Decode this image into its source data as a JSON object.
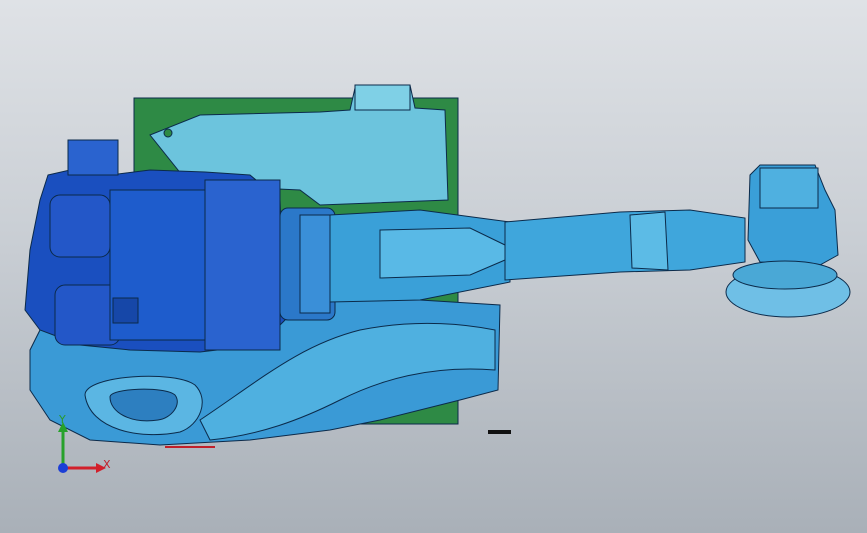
{
  "view": {
    "background_top": "#dfe2e6",
    "background_bottom": "#a9b0b8",
    "model_colors": {
      "base_plate": "#2e8a45",
      "body_light": "#4aa8d6",
      "body_dark": "#1f6fb5",
      "motor_blue": "#1a4fbf",
      "edge": "#0b2a4a",
      "arm": "#3aa0d8",
      "cyan_housing": "#6cc4dd"
    }
  },
  "triad": {
    "x_label": "X",
    "y_label": "Y",
    "x_color": "#d21f2b",
    "y_color": "#27a12b",
    "z_color": "#1c3fd6",
    "icon": "coordinate-triad-icon"
  }
}
